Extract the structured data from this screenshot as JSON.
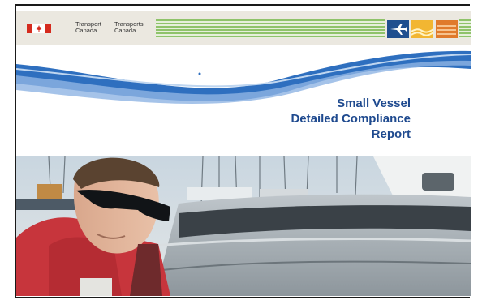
{
  "header": {
    "department_en_line1": "Transport",
    "department_en_line2": "Canada",
    "department_fr_line1": "Transports",
    "department_fr_line2": "Canada",
    "mode_icons": [
      "airplane-icon",
      "ship-icon",
      "train-icon"
    ]
  },
  "title": {
    "line1": "Small Vessel",
    "line2": "Detailed Compliance",
    "line3": "Report"
  },
  "colors": {
    "title": "#1f4a8f",
    "flag_red": "#d52b1e",
    "stripe_green": "#8fc36a",
    "swoosh_blue": "#2e6fbf"
  }
}
